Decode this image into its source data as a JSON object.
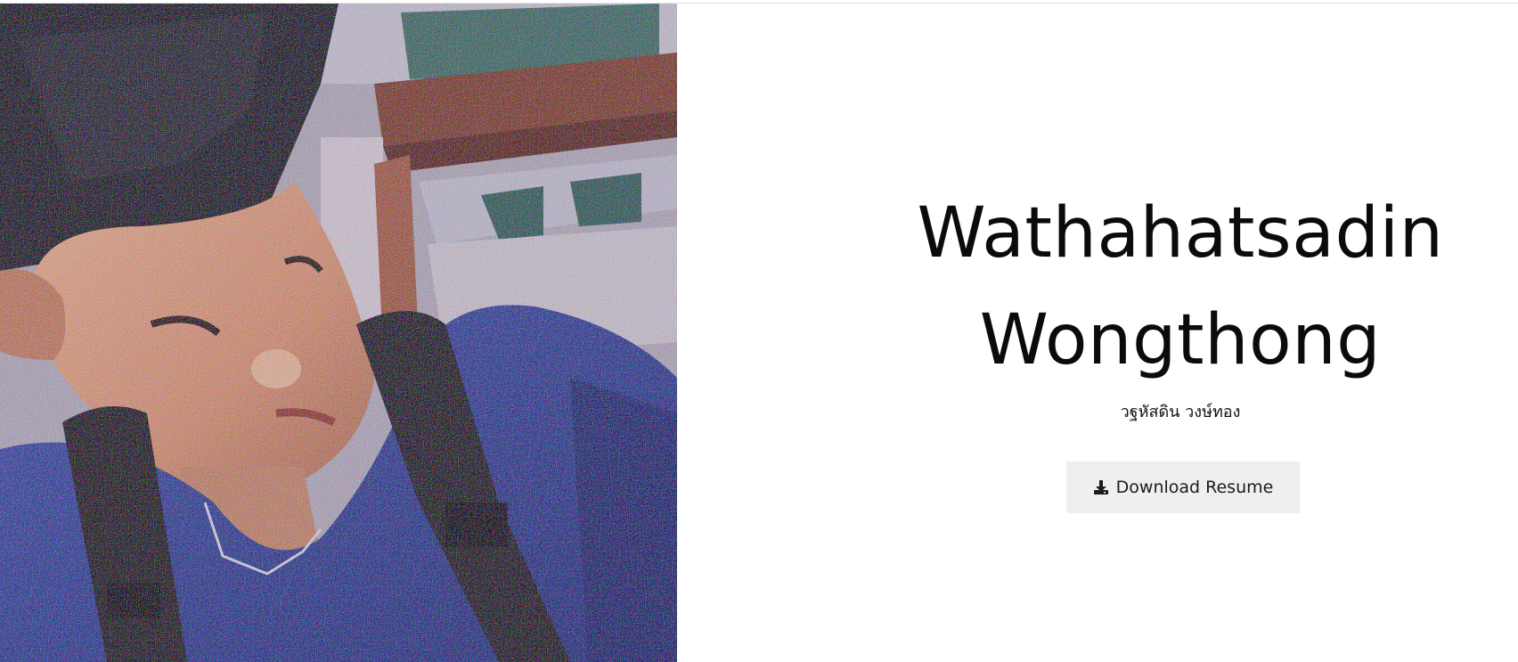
{
  "hero": {
    "name_first": "Wathahatsadin",
    "name_last": "Wongthong",
    "thai_name": "วฐหัสดิน วงษ์ทอง",
    "download_button_label": "Download Resume",
    "download_icon": "download-icon"
  },
  "photo": {
    "subject": "profile-photo"
  },
  "colors": {
    "text": "#0b0b0b",
    "button_bg": "#efefef",
    "shirt_blue": "#2b3c92"
  }
}
